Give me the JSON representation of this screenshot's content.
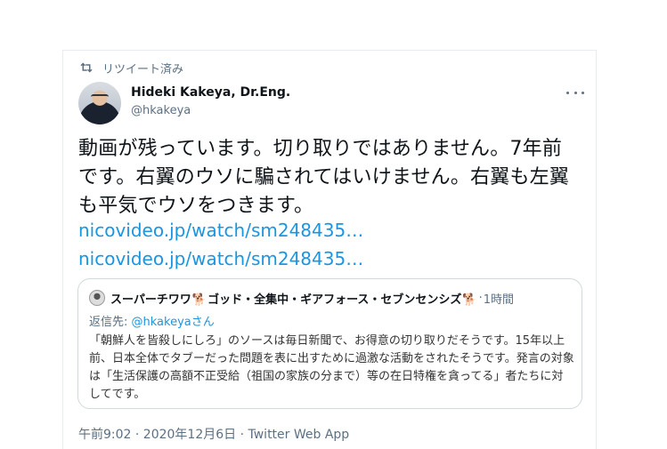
{
  "retweet": {
    "label": "リツイート済み",
    "icon": "retweet-icon"
  },
  "author": {
    "name": "Hideki Kakeya, Dr.Eng.",
    "handle": "@hkakeya"
  },
  "tweet": {
    "text": "動画が残っています。切り取りではありません。7年前です。右翼のウソに騙されてはいけません。右翼も左翼も平気でウソをつきます。",
    "links": [
      "nicovideo.jp/watch/sm248435…",
      "nicovideo.jp/watch/sm248435…"
    ]
  },
  "quote": {
    "name_part1": "スーパーチワワ",
    "dog1": "🐕",
    "name_part2": "ゴッド・全集中・ギアフォース・セブンセンシズ",
    "dog2": "🐕",
    "separator": "·",
    "time": "1時間",
    "reply_prefix": "返信先: ",
    "reply_mention": "@hkakeyaさん",
    "text": "「朝鮮人を皆殺しにしろ」のソースは毎日新聞で、お得意の切り取りだそうです。15年以上前、日本全体でタブーだった問題を表に出すために過激な活動をされたそうです。発言の対象は「生活保護の高額不正受給（祖国の家族の分まで）等の在日特権を貪ってる」者たちに対してです。"
  },
  "footer": {
    "meta": "午前9:02 · 2020年12月6日 · Twitter Web App"
  }
}
